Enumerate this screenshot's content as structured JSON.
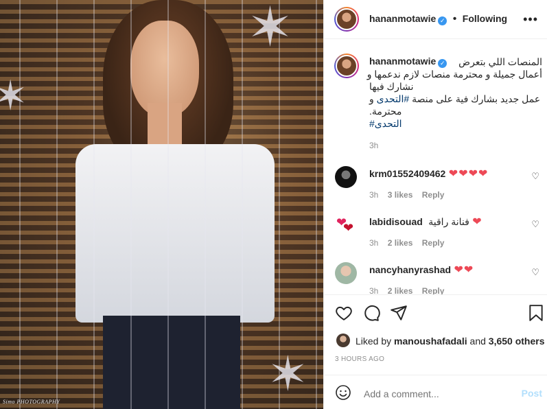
{
  "photo": {
    "watermark": "Simo PHOTOGRAPHY"
  },
  "header": {
    "username": "hananmotawie",
    "separator": "•",
    "follow_status": "Following"
  },
  "caption": {
    "username": "hananmotawie",
    "line1": "المنصات اللي بتعرض",
    "line2": "أعمال جميلة و محترمة منصات لازم ندعمها و",
    "line3": "نشارك فيها",
    "line4_prefix": "و",
    "line4_hashtag": "#التحدى",
    "line4_suffix": "عمل جديد بشارك فية على منصة",
    "line5": "محترمة.",
    "hashtag": "#التحدى",
    "time": "3h"
  },
  "comments": [
    {
      "username": "krm01552409462",
      "text": "",
      "hearts": "❤❤❤❤",
      "time": "3h",
      "likes": "3 likes",
      "reply": "Reply"
    },
    {
      "username": "labidisouad",
      "text": "فنانة راقية",
      "hearts": "❤",
      "time": "3h",
      "likes": "2 likes",
      "reply": "Reply"
    },
    {
      "username": "nancyhanyrashad",
      "text": "",
      "hearts": "❤❤",
      "time": "3h",
      "likes": "2 likes",
      "reply": "Reply"
    }
  ],
  "actions": {
    "liked_by_prefix": "Liked by",
    "liked_by_user": "manoushafadali",
    "liked_by_and": "and",
    "liked_by_count": "3,650 others",
    "post_time": "3 HOURS AGO"
  },
  "add_comment": {
    "placeholder": "Add a comment...",
    "post_label": "Post"
  }
}
